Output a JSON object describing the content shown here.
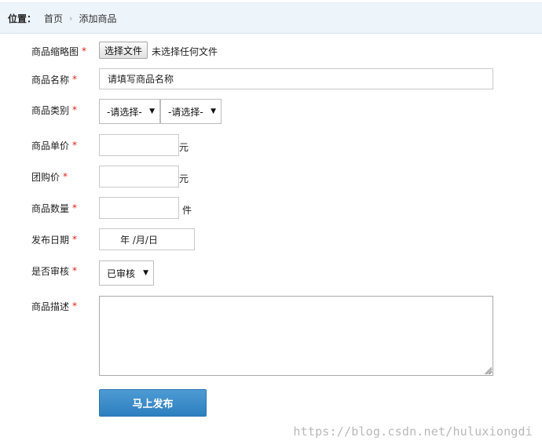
{
  "breadcrumb": {
    "label": "位置：",
    "home": "首页",
    "separator": "›",
    "current": "添加商品"
  },
  "form": {
    "thumbnail": {
      "label": "商品缩略图",
      "required_mark": "*",
      "button_label": "选择文件",
      "status": "未选择任何文件"
    },
    "name": {
      "label": "商品名称",
      "required_mark": "*",
      "placeholder": "请填写商品名称"
    },
    "category": {
      "label": "商品类别",
      "required_mark": "*",
      "select1": "-请选择-",
      "select2": "-请选择-"
    },
    "unit_price": {
      "label": "商品单价",
      "required_mark": "*",
      "value": "",
      "unit": "元"
    },
    "group_price": {
      "label": "团购价",
      "required_mark": "*",
      "value": "",
      "unit": "元"
    },
    "quantity": {
      "label": "商品数量",
      "required_mark": "*",
      "value": "",
      "unit": "件"
    },
    "publish_date": {
      "label": "发布日期",
      "required_mark": "*",
      "placeholder": "年 /月/日"
    },
    "review": {
      "label": "是否审核",
      "required_mark": "*",
      "selected": "已审核"
    },
    "description": {
      "label": "商品描述",
      "required_mark": "*",
      "value": ""
    },
    "submit_label": "马上发布"
  },
  "watermark": "https://blog.csdn.net/huluxiongdi",
  "colors": {
    "required": "#e0211a",
    "button": "#3589c9",
    "breadcrumb_bg": "#edf4fa"
  },
  "icons": {
    "select_arrow": "triangle-down-icon",
    "breadcrumb_sep": "chevron-right-icon"
  }
}
